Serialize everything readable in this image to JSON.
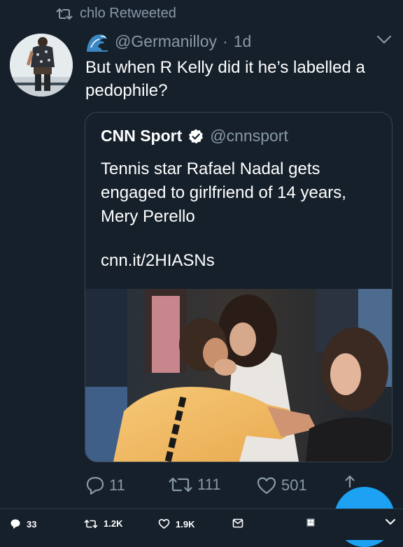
{
  "retweet_header": {
    "icon": "retweet-icon",
    "label": "chlo Retweeted"
  },
  "tweet": {
    "avatar": "user-avatar",
    "emoji": "wave-emoji",
    "handle": "@Germanilloy",
    "separator": "·",
    "time": "1d",
    "text": "But when R Kelly did it he’s labelled a pedophile?",
    "menu_icon": "chevron-down-icon"
  },
  "quoted_tweet": {
    "name": "CNN Sport",
    "verified_icon": "verified-badge-icon",
    "handle": "@cnnsport",
    "text": "Tennis star Rafael Nadal gets engaged to girlfriend of 14 years, Mery Perello",
    "link": "cnn.it/2HIASNs",
    "image": "photo-couple-kissing"
  },
  "actions": {
    "reply_count": "11",
    "retweet_count": "111",
    "like_count": "501",
    "share_icon": "share-icon"
  },
  "compose_button": "compose-fab",
  "bottom_bar": {
    "replies": "33",
    "retweets": "1.2K",
    "likes": "1.9K",
    "dm_icon": "mail-icon",
    "extra_icon": "grid-icon",
    "expand_icon": "chevron-down-icon"
  },
  "colors": {
    "background": "#15202b",
    "muted_text": "#8899a6",
    "border": "#38444d",
    "accent": "#1da1f2"
  }
}
